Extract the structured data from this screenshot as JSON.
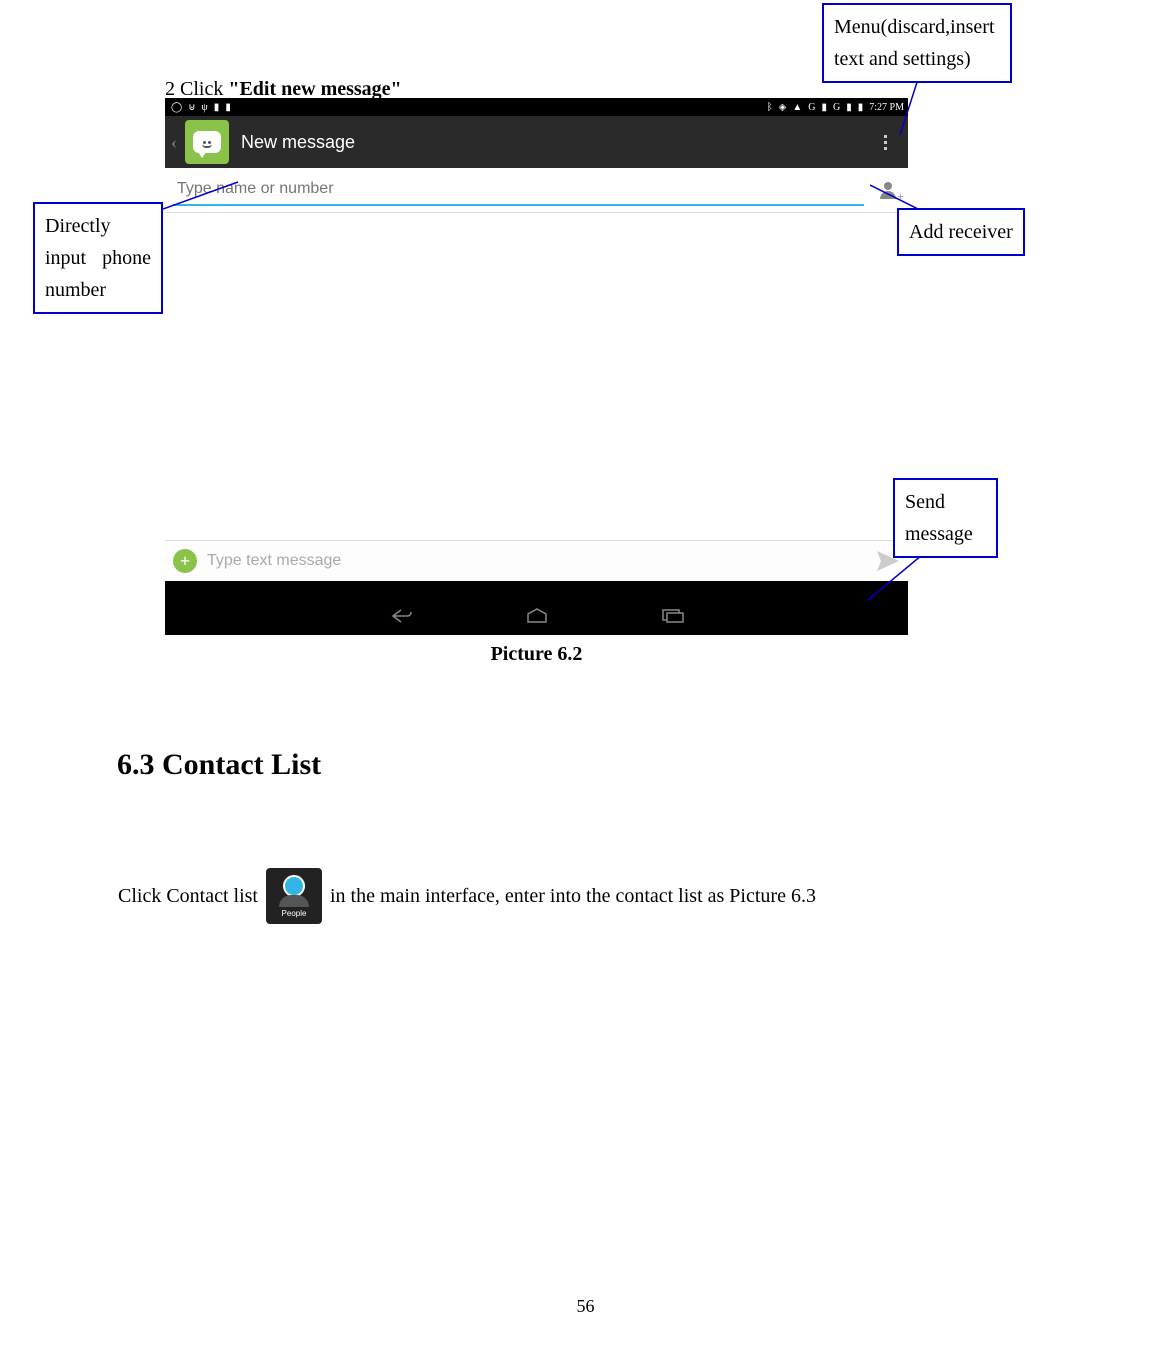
{
  "callouts": {
    "menu": "Menu(discard,insert text and settings)",
    "add_receiver": "Add receiver",
    "input_number": "Directly input phone number",
    "send_message": "Send message"
  },
  "instruction": {
    "prefix": "2 Click ",
    "bold": "\"Edit new message\""
  },
  "screenshot": {
    "status_time": "7:27 PM",
    "status_signal": "G",
    "app_title": "New message",
    "recipient_placeholder": "Type name or number",
    "message_placeholder": "Type text message"
  },
  "caption": "Picture 6.2",
  "section_heading": "6.3 Contact List",
  "body": {
    "before": "Click Contact list ",
    "after": " in the main interface, enter into the contact list as Picture 6.3",
    "icon_label": "People"
  },
  "page_number": "56"
}
